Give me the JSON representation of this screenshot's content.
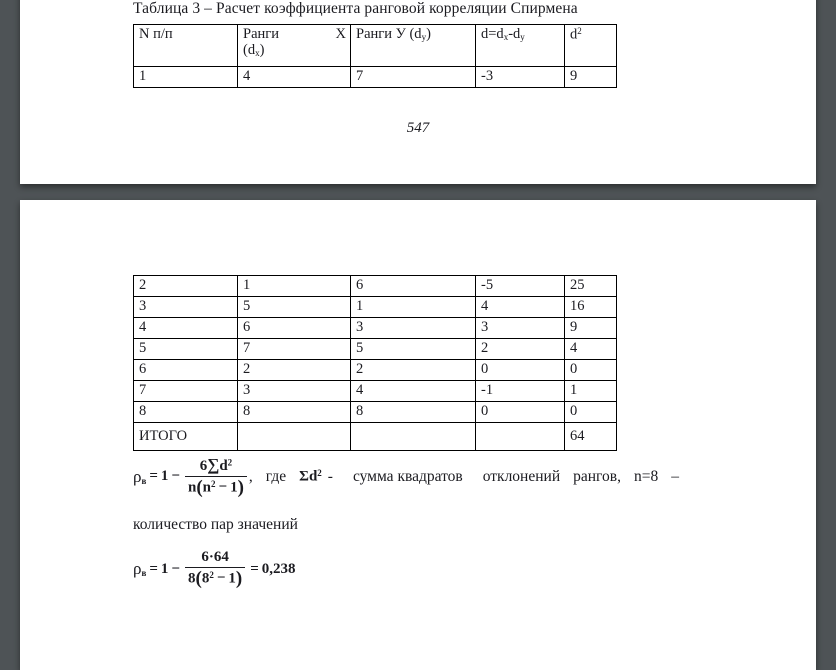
{
  "viewer": {
    "background_color": "#4e5356",
    "page_color": "#ffffff"
  },
  "page_one": {
    "caption": "Таблица 3 – Расчет коэффициента ранговой корреляции Спирмена",
    "page_number": "547",
    "table": {
      "headers": {
        "col1": "N п/п",
        "col2_line1_left": "Ранги",
        "col2_line1_right": "X",
        "col2_line2": "(d",
        "col2_line2_sub": "x",
        "col2_line2_end": ")",
        "col3_text": "Ранги У (d",
        "col3_sub": "y",
        "col3_end": ")",
        "col4_text_a": "d=d",
        "col4_sub_a": "x",
        "col4_text_b": "-d",
        "col4_sub_b": "y",
        "col5_text": "d",
        "col5_sup": "2"
      },
      "rows": [
        [
          "1",
          "4",
          "7",
          "-3",
          "9"
        ]
      ]
    }
  },
  "page_two": {
    "table": {
      "rows": [
        [
          "2",
          "1",
          "6",
          "-5",
          "25"
        ],
        [
          "3",
          "5",
          "1",
          "4",
          "16"
        ],
        [
          "4",
          "6",
          "3",
          "3",
          "9"
        ],
        [
          "5",
          "7",
          "5",
          "2",
          "4"
        ],
        [
          "6",
          "2",
          "2",
          "0",
          "0"
        ],
        [
          "7",
          "3",
          "4",
          "-1",
          "1"
        ],
        [
          "8",
          "8",
          "8",
          "0",
          "0"
        ]
      ],
      "total_row": {
        "label": "ИТОГО",
        "c2": "",
        "c3": "",
        "c4": "",
        "total": "64"
      }
    },
    "formula_main": {
      "rho_symbol": "ρ",
      "rho_subscript": "в",
      "equals": "=",
      "one": "1",
      "minus": "−",
      "numerator_coef": "6",
      "sum_symbol": "∑",
      "numerator_var": "d",
      "numerator_sup": "2",
      "denominator_n": "n",
      "denominator_open": "(",
      "denominator_n2": "n",
      "denominator_n2_sup": "2",
      "denominator_minus": "−",
      "denominator_one": "1",
      "denominator_close": ")",
      "comma": ",",
      "where_word": "где",
      "sum_d2_sum": "Σ",
      "sum_d2_var": "d",
      "sum_d2_sup": "2",
      "dash": "-",
      "definition_a": "сумма квадратов",
      "definition_b": "отклонений",
      "definition_c": "рангов,",
      "definition_d": "n=8",
      "definition_e": "–"
    },
    "prose_line": "количество пар значений",
    "formula_result": {
      "rho_symbol": "ρ",
      "rho_subscript": "в",
      "equals": "=",
      "one": "1",
      "minus": "−",
      "numerator": "6·64",
      "denominator_n": "8",
      "denominator_open": "(",
      "denominator_base": "8",
      "denominator_sup": "2",
      "denominator_minus": "−",
      "denominator_one": "1",
      "denominator_close": ")",
      "equals2": "=",
      "result": "0,238"
    }
  }
}
